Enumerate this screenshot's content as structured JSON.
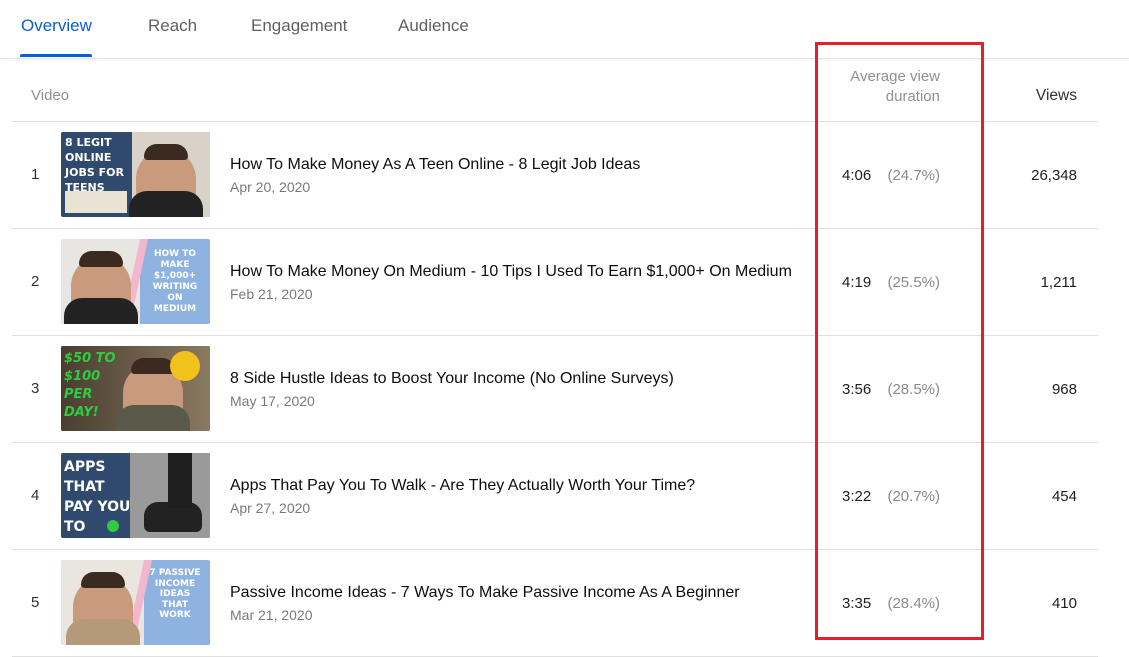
{
  "tabs": [
    {
      "label": "Overview",
      "active": true
    },
    {
      "label": "Reach",
      "active": false
    },
    {
      "label": "Engagement",
      "active": false
    },
    {
      "label": "Audience",
      "active": false
    }
  ],
  "table": {
    "headers": {
      "video": "Video",
      "avg_view_duration_line1": "Average view",
      "avg_view_duration_line2": "duration",
      "views": "Views"
    },
    "rows": [
      {
        "rank": "1",
        "title": "How To Make Money As A Teen Online - 8 Legit Job Ideas",
        "date": "Apr 20, 2020",
        "duration": "4:06",
        "percent": "(24.7%)",
        "views": "26,348",
        "thumb_text": "8 LEGIT ONLINE JOBS FOR TEENS"
      },
      {
        "rank": "2",
        "title": "How To Make Money On Medium - 10 Tips I Used To Earn $1,000+ On Medium",
        "date": "Feb 21, 2020",
        "duration": "4:19",
        "percent": "(25.5%)",
        "views": "1,211",
        "thumb_text": "HOW TO MAKE $1,000+ WRITING ON MEDIUM"
      },
      {
        "rank": "3",
        "title": "8 Side Hustle Ideas to Boost Your Income (No Online Surveys)",
        "date": "May 17, 2020",
        "duration": "3:56",
        "percent": "(28.5%)",
        "views": "968",
        "thumb_text": "$50 TO $100 PER DAY!"
      },
      {
        "rank": "4",
        "title": "Apps That Pay You To Walk - Are They Actually Worth Your Time?",
        "date": "Apr 27, 2020",
        "duration": "3:22",
        "percent": "(20.7%)",
        "views": "454",
        "thumb_text": "APPS THAT PAY YOU TO WALK"
      },
      {
        "rank": "5",
        "title": "Passive Income Ideas - 7 Ways To Make Passive Income As A Beginner",
        "date": "Mar 21, 2020",
        "duration": "3:35",
        "percent": "(28.4%)",
        "views": "410",
        "thumb_text": "7 PASSIVE INCOME IDEAS THAT WORK"
      }
    ]
  },
  "colors": {
    "accent": "#065fd4",
    "highlight": "#e3202c"
  }
}
